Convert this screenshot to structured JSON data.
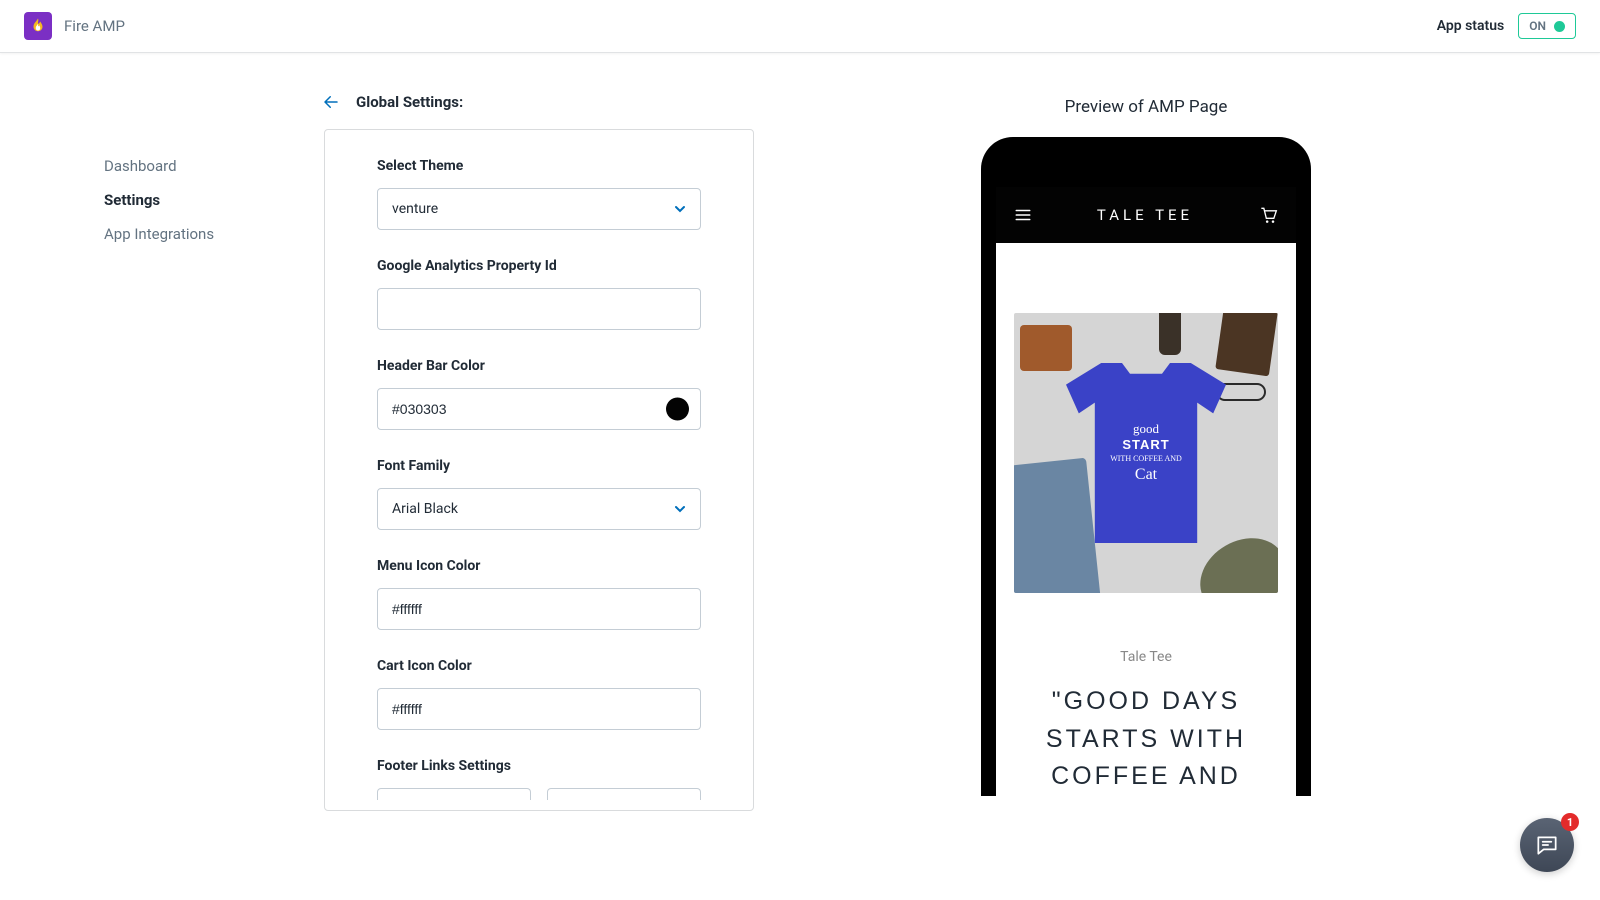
{
  "header": {
    "app_name": "Fire AMP",
    "status_label": "App status",
    "status_value": "ON"
  },
  "sidebar": {
    "items": [
      {
        "label": "Dashboard"
      },
      {
        "label": "Settings"
      },
      {
        "label": "App Integrations"
      }
    ]
  },
  "breadcrumb": {
    "title": "Global Settings:"
  },
  "settings": {
    "theme_label": "Select Theme",
    "theme_value": "venture",
    "ga_label": "Google Analytics Property Id",
    "ga_value": "",
    "header_color_label": "Header Bar Color",
    "header_color_value": "#030303",
    "font_label": "Font Family",
    "font_value": "Arial Black",
    "menu_icon_label": "Menu Icon Color",
    "menu_icon_value": "#ffffff",
    "cart_icon_label": "Cart Icon Color",
    "cart_icon_value": "#ffffff",
    "footer_label": "Footer Links Settings"
  },
  "preview": {
    "title": "Preview of AMP Page",
    "phone_header_title": "TALE TEE",
    "brand_sub": "Tale Tee",
    "product_title": "\"GOOD DAYS STARTS WITH COFFEE AND"
  },
  "chat": {
    "badge": "1"
  }
}
